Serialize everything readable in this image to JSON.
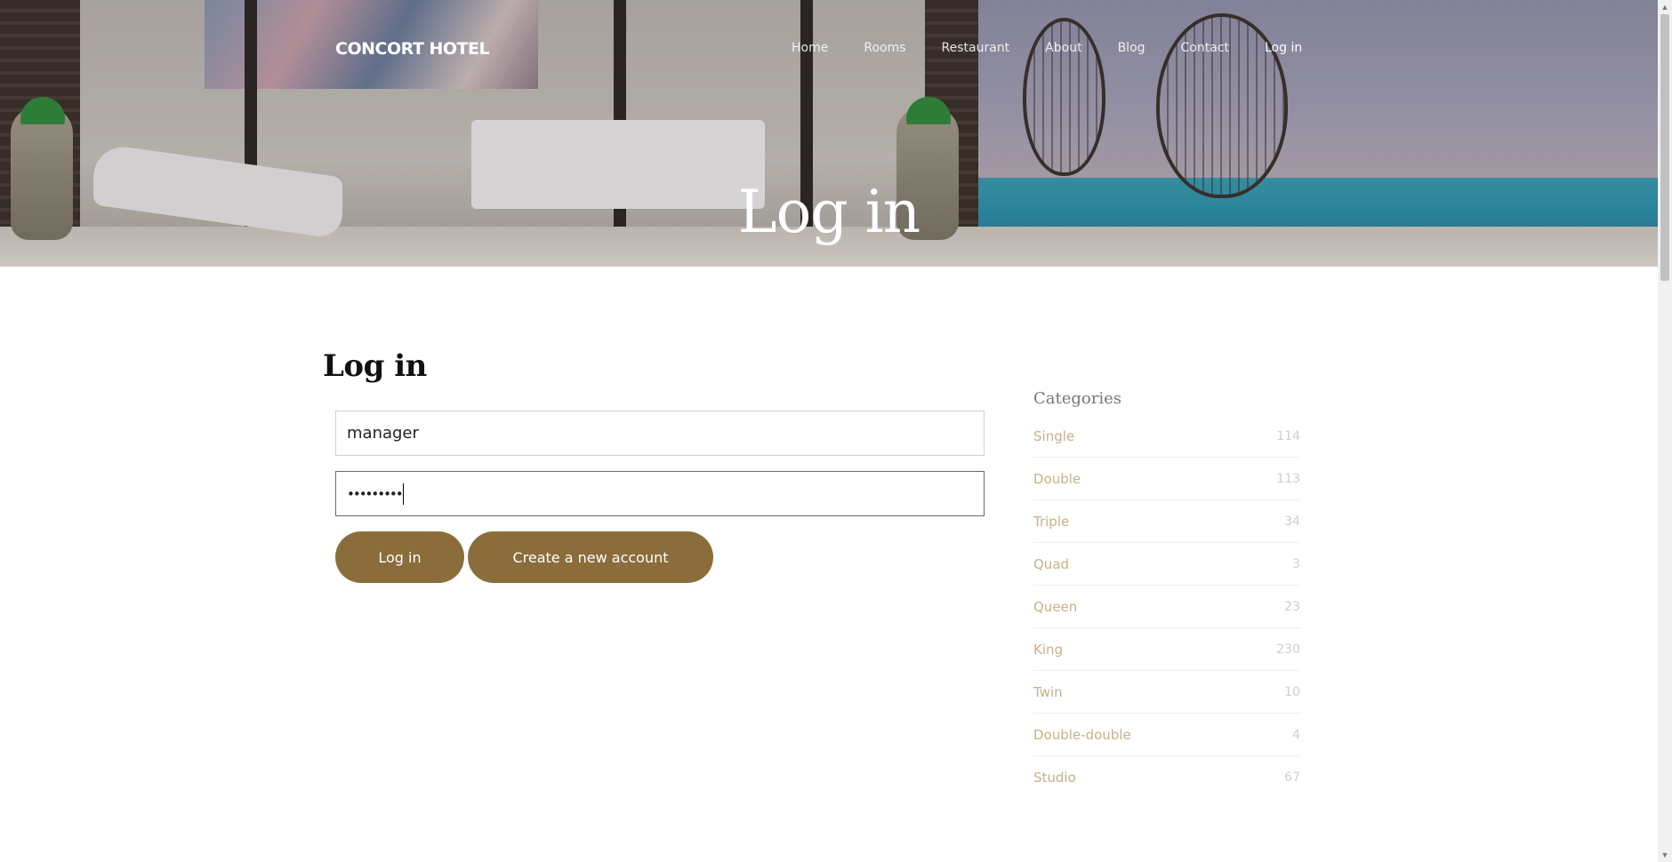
{
  "header": {
    "brand": "CONCORT HOTEL",
    "nav": [
      {
        "label": "Home"
      },
      {
        "label": "Rooms"
      },
      {
        "label": "Restaurant"
      },
      {
        "label": "About"
      },
      {
        "label": "Blog"
      },
      {
        "label": "Contact"
      },
      {
        "label": "Log in"
      }
    ],
    "hero_title": "Log in"
  },
  "login": {
    "title": "Log in",
    "username_value": "manager",
    "password_value": "•••••••••",
    "login_button": "Log in",
    "create_account_button": "Create a new account"
  },
  "sidebar": {
    "title": "Categories",
    "categories": [
      {
        "name": "Single",
        "count": "114"
      },
      {
        "name": "Double",
        "count": "113"
      },
      {
        "name": "Triple",
        "count": "34"
      },
      {
        "name": "Quad",
        "count": "3"
      },
      {
        "name": "Queen",
        "count": "23"
      },
      {
        "name": "King",
        "count": "230"
      },
      {
        "name": "Twin",
        "count": "10"
      },
      {
        "name": "Double-double",
        "count": "4"
      },
      {
        "name": "Studio",
        "count": "67"
      }
    ]
  },
  "colors": {
    "accent": "#8a6d3b",
    "category_text": "#c8b089"
  }
}
